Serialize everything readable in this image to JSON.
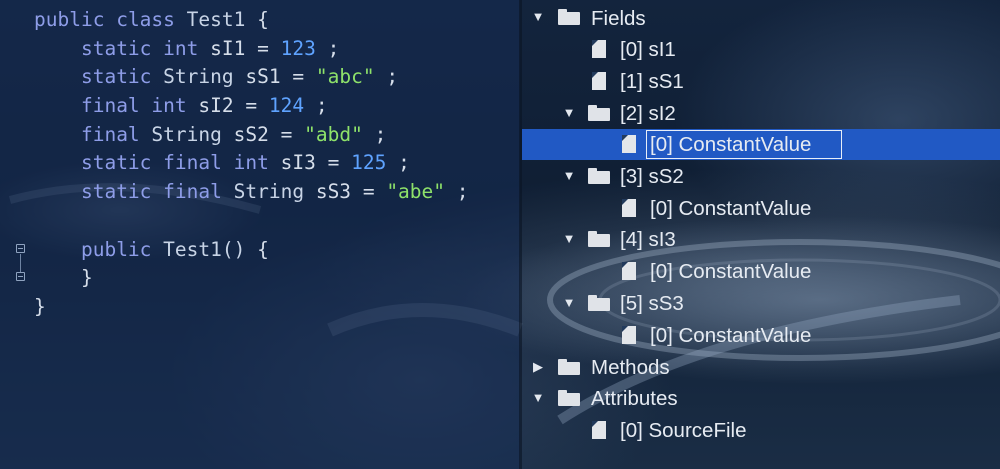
{
  "editor": {
    "lines": [
      [
        [
          "kw",
          "public"
        ],
        [
          "kw",
          "class"
        ],
        [
          "ty",
          "Test1"
        ],
        [
          "plain",
          "{"
        ]
      ],
      [
        [
          "kw",
          "static"
        ],
        [
          "kw",
          "int"
        ],
        [
          "plain",
          "sI1"
        ],
        [
          "plain",
          "="
        ],
        [
          "num",
          "123"
        ],
        [
          "plain",
          ";"
        ]
      ],
      [
        [
          "kw",
          "static"
        ],
        [
          "ty",
          "String"
        ],
        [
          "plain",
          "sS1"
        ],
        [
          "plain",
          "="
        ],
        [
          "str",
          "\"abc\""
        ],
        [
          "plain",
          ";"
        ]
      ],
      [
        [
          "kw",
          "final"
        ],
        [
          "kw",
          "int"
        ],
        [
          "plain",
          "sI2"
        ],
        [
          "plain",
          "="
        ],
        [
          "num",
          "124"
        ],
        [
          "plain",
          ";"
        ]
      ],
      [
        [
          "kw",
          "final"
        ],
        [
          "ty",
          "String"
        ],
        [
          "plain",
          "sS2"
        ],
        [
          "plain",
          "="
        ],
        [
          "str",
          "\"abd\""
        ],
        [
          "plain",
          ";"
        ]
      ],
      [
        [
          "kw",
          "static"
        ],
        [
          "kw",
          "final"
        ],
        [
          "kw",
          "int"
        ],
        [
          "plain",
          "sI3"
        ],
        [
          "plain",
          "="
        ],
        [
          "num",
          "125"
        ],
        [
          "plain",
          ";"
        ]
      ],
      [
        [
          "kw",
          "static"
        ],
        [
          "kw",
          "final"
        ],
        [
          "ty",
          "String"
        ],
        [
          "plain",
          "sS3"
        ],
        [
          "plain",
          "="
        ],
        [
          "str",
          "\"abe\""
        ],
        [
          "plain",
          ";"
        ]
      ],
      [],
      [
        [
          "kw",
          "public"
        ],
        [
          "ty",
          "Test1()"
        ],
        [
          "plain",
          "{"
        ]
      ],
      [
        [
          "plain",
          "}"
        ]
      ],
      [
        [
          "plain",
          "}"
        ]
      ]
    ],
    "indents": [
      0,
      1,
      1,
      1,
      1,
      1,
      1,
      0,
      1,
      1,
      0
    ]
  },
  "tree": {
    "fields_label": "Fields",
    "field_0": "[0] sI1",
    "field_1": "[1] sS1",
    "field_2": "[2] sI2",
    "field_2_child": "[0] ConstantValue",
    "field_3": "[3] sS2",
    "field_3_child": "[0] ConstantValue",
    "field_4": "[4] sI3",
    "field_4_child": "[0] ConstantValue",
    "field_5": "[5] sS3",
    "field_5_child": "[0] ConstantValue",
    "methods_label": "Methods",
    "attributes_label": "Attributes",
    "attribute_0": "[0] SourceFile",
    "selected_item": "[0] ConstantValue"
  },
  "colors": {
    "selection": "#2159c4",
    "keyword": "#8e9de8",
    "string": "#8ee26a",
    "number": "#5fa3ff"
  },
  "icons": [
    "folder-icon",
    "file-icon",
    "expand-arrow-icon",
    "collapse-arrow-icon",
    "fold-marker-icon"
  ]
}
